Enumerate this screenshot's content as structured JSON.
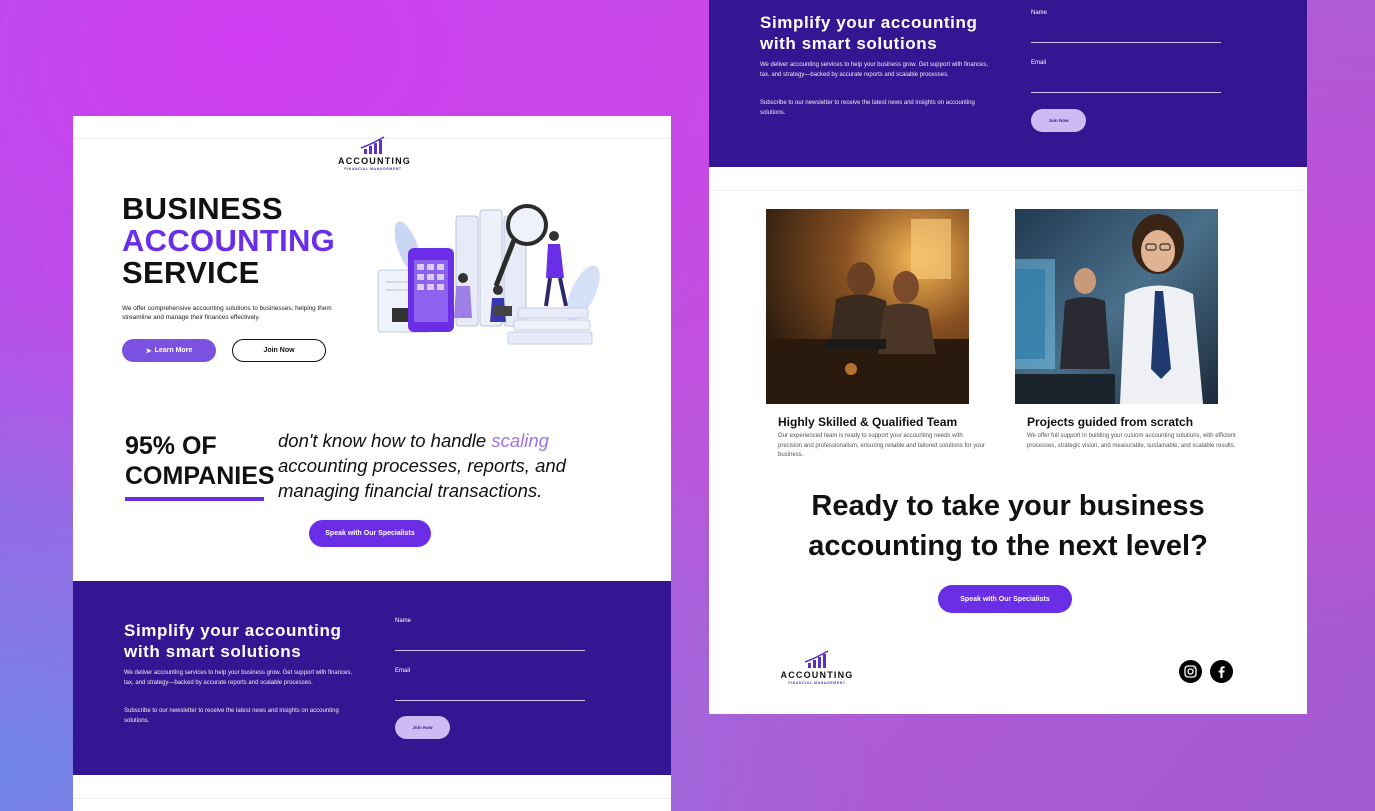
{
  "brand": {
    "logo_word": "ACCOUNTING",
    "logo_sub": "FINANCIAL MANAGEMENT"
  },
  "hero": {
    "title_line1": "BUSINESS",
    "title_line2": "ACCOUNTING",
    "title_line3": "SERVICE",
    "description": "We offer comprehensive accounting solutions to businesses, helping them streamline and manage their finances effectively.",
    "learn_more": "Learn More",
    "join_now": "Join Now"
  },
  "stats": {
    "big_line1": "95% OF",
    "big_line2": "COMPANIES",
    "text_before": "don't know how to handle ",
    "text_accent": "scaling",
    "text_after": " accounting processes, reports, and managing financial transactions.",
    "cta_button": "Speak with Our Specialists"
  },
  "newsletter": {
    "title": "Simplify your accounting with smart solutions",
    "description": "We deliver accounting services to help your business grow. Get support with finances, tax, and strategy—backed by accurate reports and scalable processes.",
    "subscribe_text": "Subscribe to our newsletter to receive the latest news and insights on accounting solutions.",
    "name_label": "Name",
    "email_label": "Email",
    "button": "Join Now"
  },
  "features": [
    {
      "title": "Highly Skilled & Qualified Team",
      "description": "Our experienced team is ready to support your accounting needs with precision and professionalism, ensuring reliable and tailored solutions for your business."
    },
    {
      "title": "Projects guided from scratch",
      "description": "We offer full support in building your custom accounting solutions, with efficient processes, strategic vision, and measurable, sustainable, and scalable results."
    }
  ],
  "cta": {
    "line1": "Ready to take your business",
    "line2": "accounting to the next level?",
    "button": "Speak with Our Specialists"
  },
  "footer": {
    "social": [
      "instagram-icon",
      "facebook-icon"
    ]
  },
  "colors": {
    "brand_purple": "#6a2ee6",
    "newsletter_bg": "#351692"
  }
}
